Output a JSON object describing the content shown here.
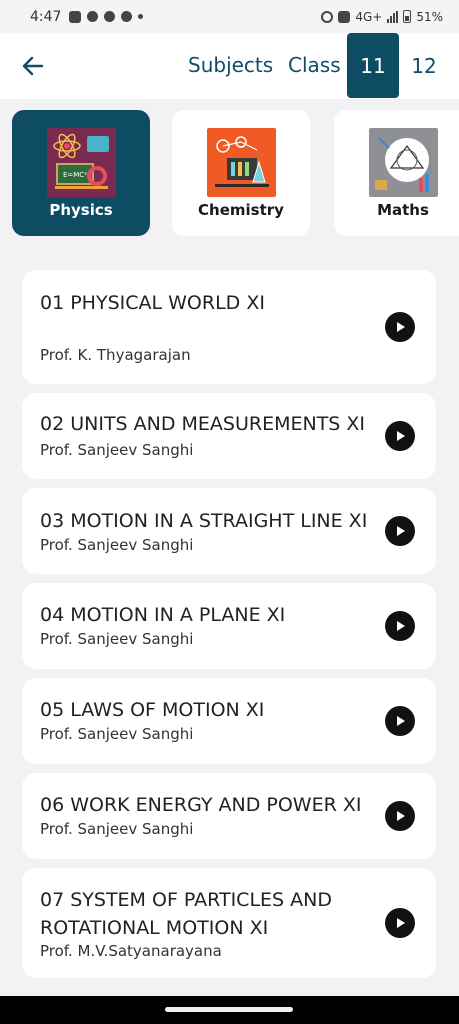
{
  "status_bar": {
    "time": "4:47",
    "network": "4G+",
    "battery": "51%"
  },
  "header": {
    "subjects_label": "Subjects",
    "class_label": "Class",
    "class_options": [
      "11",
      "12"
    ],
    "selected_class": "11"
  },
  "subjects": [
    {
      "label": "Physics",
      "icon": "physics-icon",
      "selected": true
    },
    {
      "label": "Chemistry",
      "icon": "chemistry-icon",
      "selected": false
    },
    {
      "label": "Maths",
      "icon": "maths-icon",
      "selected": false
    }
  ],
  "physics_thumb_text": "E=MC²",
  "lectures": [
    {
      "title": "01 PHYSICAL WORLD XI",
      "professor": "Prof. K. Thyagarajan"
    },
    {
      "title": "02 UNITS AND MEASUREMENTS XI",
      "professor": "Prof. Sanjeev Sanghi"
    },
    {
      "title": "03 MOTION IN A STRAIGHT LINE XI",
      "professor": "Prof. Sanjeev Sanghi"
    },
    {
      "title": "04 MOTION IN A PLANE XI",
      "professor": "Prof. Sanjeev Sanghi"
    },
    {
      "title": "05 LAWS OF MOTION XI",
      "professor": "Prof. Sanjeev Sanghi"
    },
    {
      "title": "06 WORK ENERGY AND POWER XI",
      "professor": "Prof. Sanjeev Sanghi"
    },
    {
      "title": "07 SYSTEM OF PARTICLES AND ROTATIONAL MOTION XI",
      "professor": "Prof. M.V.Satyanarayana"
    }
  ],
  "colors": {
    "accent": "#0e4c64",
    "header_text": "#0f4d6b",
    "background": "#f2f2f4"
  }
}
